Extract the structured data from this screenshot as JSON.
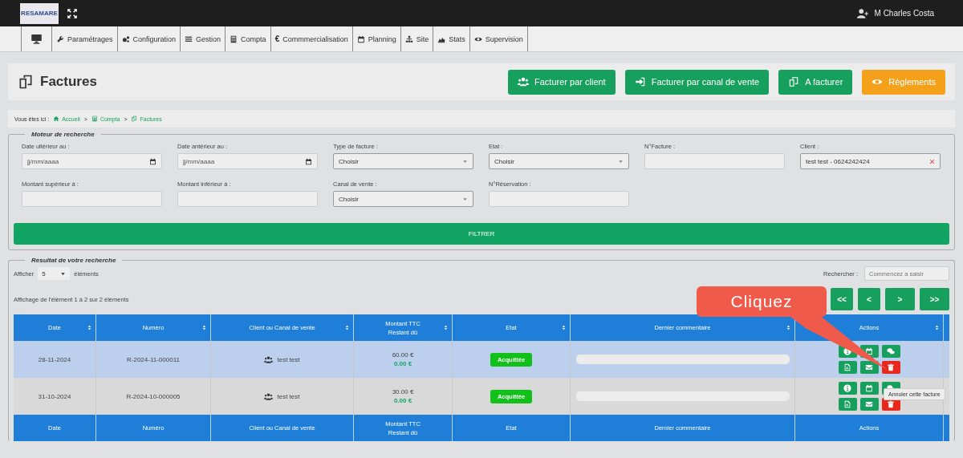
{
  "topbar": {
    "logo": "RESAMARE",
    "user": "M Charles Costa"
  },
  "nav": [
    {
      "label": "Paramétrages"
    },
    {
      "label": "Configuration"
    },
    {
      "label": "Gestion"
    },
    {
      "label": "Compta"
    },
    {
      "glyph": "€",
      "label": "Commmercialisation"
    },
    {
      "label": "Planning"
    },
    {
      "label": "Site"
    },
    {
      "label": "Stats"
    },
    {
      "label": "Supervision"
    }
  ],
  "page": {
    "title": "Factures",
    "buttons": [
      {
        "label": "Facturer par client",
        "kind": "primary"
      },
      {
        "label": "Facturer par canal de vente",
        "kind": "primary"
      },
      {
        "label": "A facturer",
        "kind": "primary"
      },
      {
        "label": "Règlements",
        "kind": "warning"
      }
    ]
  },
  "breadcrumb": {
    "prefix": "Vous êtes ici :",
    "separator": ">",
    "items": [
      {
        "label": "Accueil"
      },
      {
        "label": "Compta"
      },
      {
        "label": "Factures"
      }
    ]
  },
  "search": {
    "legend": "Moteur de recherche",
    "fields": [
      {
        "label": "Date ultérieur au :",
        "kind": "date",
        "placeholder": "jj/mm/aaaa"
      },
      {
        "label": "Date antérieur au :",
        "kind": "date",
        "placeholder": "jj/mm/aaaa"
      },
      {
        "label": "Type de facture :",
        "kind": "select",
        "value": "Choisir"
      },
      {
        "label": "Etat :",
        "kind": "select",
        "value": "Choisir"
      },
      {
        "label": "N°Facture :",
        "kind": "text"
      },
      {
        "label": "Client :",
        "kind": "client",
        "value": "test test - 0624242424"
      },
      {
        "label": "Montant supérieur à :",
        "kind": "text"
      },
      {
        "label": "Montant inférieur à :",
        "kind": "text"
      },
      {
        "label": "Canal de vente :",
        "kind": "select",
        "value": "Choisir"
      },
      {
        "label": "N°Réservation :",
        "kind": "text"
      }
    ],
    "button": "FILTRER"
  },
  "results": {
    "legend": "Resultat de votre recherche",
    "show_label": "Afficher",
    "show_value": "5",
    "show_suffix": "éléments",
    "search_label": "Rechercher :",
    "search_placeholder": "Commencez a saisir",
    "info": "Affichage de l'élément 1 à 2 sur 2 éléments",
    "pagination": [
      "<<",
      "<",
      ">",
      ">>"
    ],
    "columns": [
      {
        "label": "Date"
      },
      {
        "label": "Numéro"
      },
      {
        "label": "Client ou Canal de vente"
      },
      {
        "label": "Montant TTC\nRestant dû"
      },
      {
        "label": "Etat"
      },
      {
        "label": "Dernier commentaire"
      },
      {
        "label": "Actions"
      }
    ],
    "footer_columns": [
      {
        "label": "Date"
      },
      {
        "label": "Numéro"
      },
      {
        "label": "Client ou Canal de vente"
      },
      {
        "label": "Montant TTC\nRestant dû"
      },
      {
        "label": "Etat"
      },
      {
        "label": "Dernier commentaire"
      },
      {
        "label": "Actions"
      }
    ],
    "rows": [
      {
        "selected": true,
        "date": "28-11-2024",
        "numero": "R-2024-11-000011",
        "client": "test test",
        "montant": "60.00 €",
        "restant": "0.00 €",
        "etat": "Acquittée"
      },
      {
        "selected": false,
        "date": "31-10-2024",
        "numero": "R-2024-10-000005",
        "client": "test test",
        "montant": "30.00 €",
        "restant": "0.00 €",
        "etat": "Acquittée"
      }
    ]
  },
  "callout": "Cliquez",
  "tooltip": "Annuler cette facture"
}
